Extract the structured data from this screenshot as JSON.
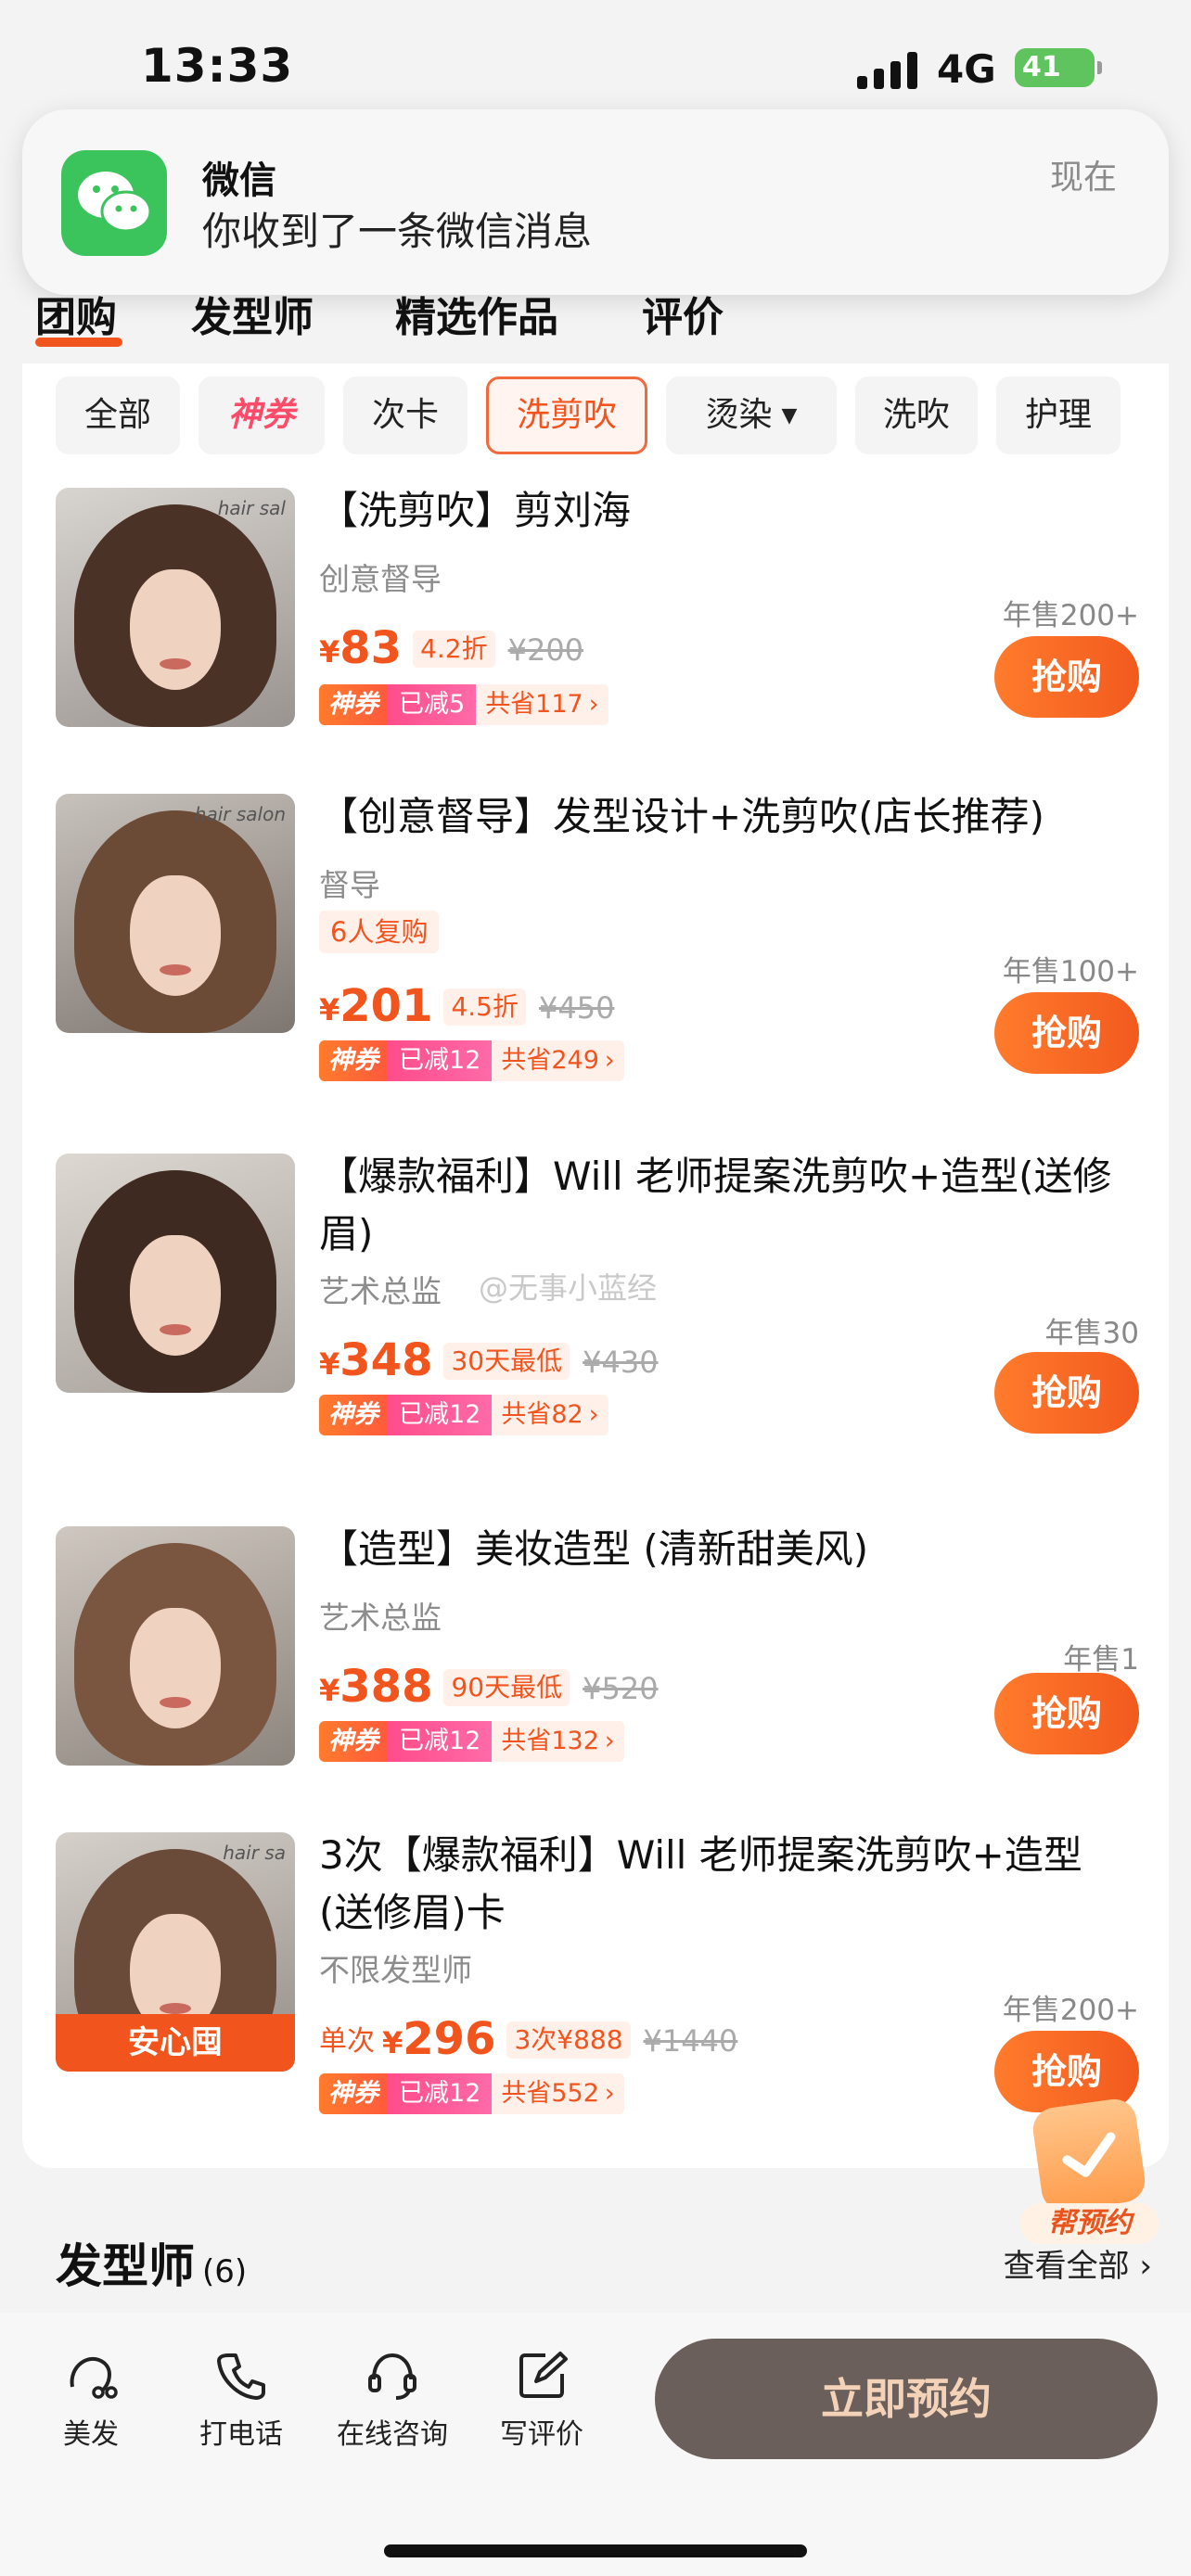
{
  "status_bar": {
    "time": "13:33",
    "network": "4G",
    "battery": "41"
  },
  "notification": {
    "app": "微信",
    "message": "你收到了一条微信消息",
    "time": "现在"
  },
  "tabs": [
    "团购",
    "发型师",
    "精选作品",
    "评价"
  ],
  "filters": [
    "全部",
    "神券",
    "次卡",
    "洗剪吹",
    "烫染",
    "洗吹",
    "护理"
  ],
  "products": [
    {
      "title": "【洗剪吹】剪刘海",
      "subtitle": "创意督导",
      "price": "83",
      "discount": "4.2折",
      "original": "¥200",
      "promo_label": "神券",
      "promo_reduce": "已减5",
      "promo_save": "共省117",
      "sales": "年售200+",
      "buy": "抢购"
    },
    {
      "title": "【创意督导】发型设计+洗剪吹(店长推荐)",
      "subtitle": "督导",
      "repeat": "6人复购",
      "price": "201",
      "discount": "4.5折",
      "original": "¥450",
      "promo_label": "神券",
      "promo_reduce": "已减12",
      "promo_save": "共省249",
      "sales": "年售100+",
      "buy": "抢购"
    },
    {
      "title": "【爆款福利】Will 老师提案洗剪吹+造型(送修眉)",
      "subtitle": "艺术总监",
      "price": "348",
      "discount": "30天最低",
      "original": "¥430",
      "promo_label": "神券",
      "promo_reduce": "已减12",
      "promo_save": "共省82",
      "sales": "年售30",
      "buy": "抢购"
    },
    {
      "title": "【造型】美妆造型 (清新甜美风)",
      "subtitle": "艺术总监",
      "price": "388",
      "discount": "90天最低",
      "original": "¥520",
      "promo_label": "神券",
      "promo_reduce": "已减12",
      "promo_save": "共省132",
      "sales": "年售1",
      "buy": "抢购"
    },
    {
      "title": "3次【爆款福利】Will 老师提案洗剪吹+造型(送修眉)卡",
      "subtitle": "不限发型师",
      "per_label": "单次",
      "price": "296",
      "discount": "3次¥888",
      "original": "¥1440",
      "promo_label": "神券",
      "promo_reduce": "已减12",
      "promo_save": "共省552",
      "sales": "年售200+",
      "buy": "抢购",
      "thumb_badge": "安心囤"
    }
  ],
  "currency": "¥",
  "watermark": "@无事小蓝经",
  "floating_button": "帮预约",
  "stylists_section": {
    "title": "发型师",
    "count": "(6)",
    "view_all": "查看全部"
  },
  "bottom_nav": {
    "items": [
      "美发",
      "打电话",
      "在线咨询",
      "写评价"
    ],
    "book_label": "立即预约"
  },
  "colors": {
    "accent": "#f2541e",
    "wechat_green": "#3cc45c",
    "book_button": "#6a5f5a"
  }
}
